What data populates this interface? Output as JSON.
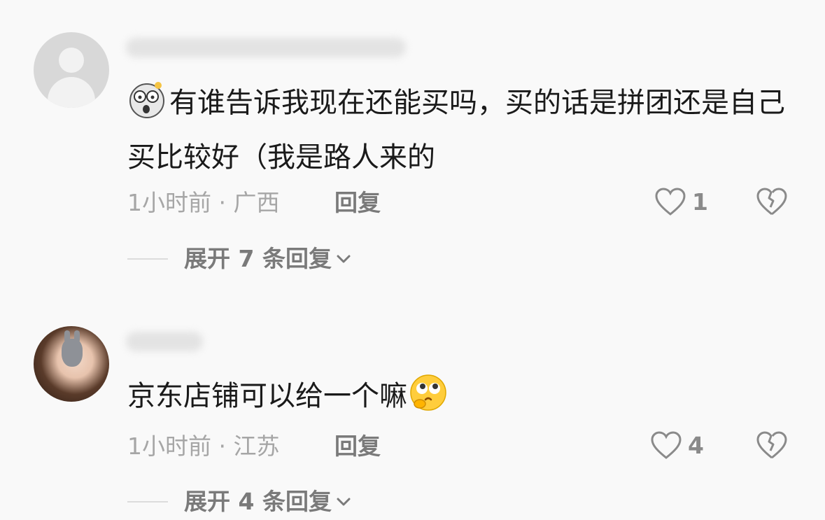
{
  "comments": [
    {
      "text": "有谁告诉我现在还能买吗，买的话是拼团还是自己买比较好（我是路人来的",
      "time_location": "1小时前 · 广西",
      "reply_label": "回复",
      "like_count": "1",
      "expand_label": "展开 7 条回复",
      "emoji": "shocked-face-icon"
    },
    {
      "text": "京东店铺可以给一个嘛",
      "time_location": "1小时前 · 江苏",
      "reply_label": "回复",
      "like_count": "4",
      "expand_label": "展开 4 条回复",
      "emoji": "thinking-pleading-face-icon"
    }
  ],
  "colors": {
    "background": "#f9f9f9",
    "text_primary": "#1a1a1a",
    "text_secondary": "#a6a6a6",
    "reply_text": "#7a7a7a"
  }
}
